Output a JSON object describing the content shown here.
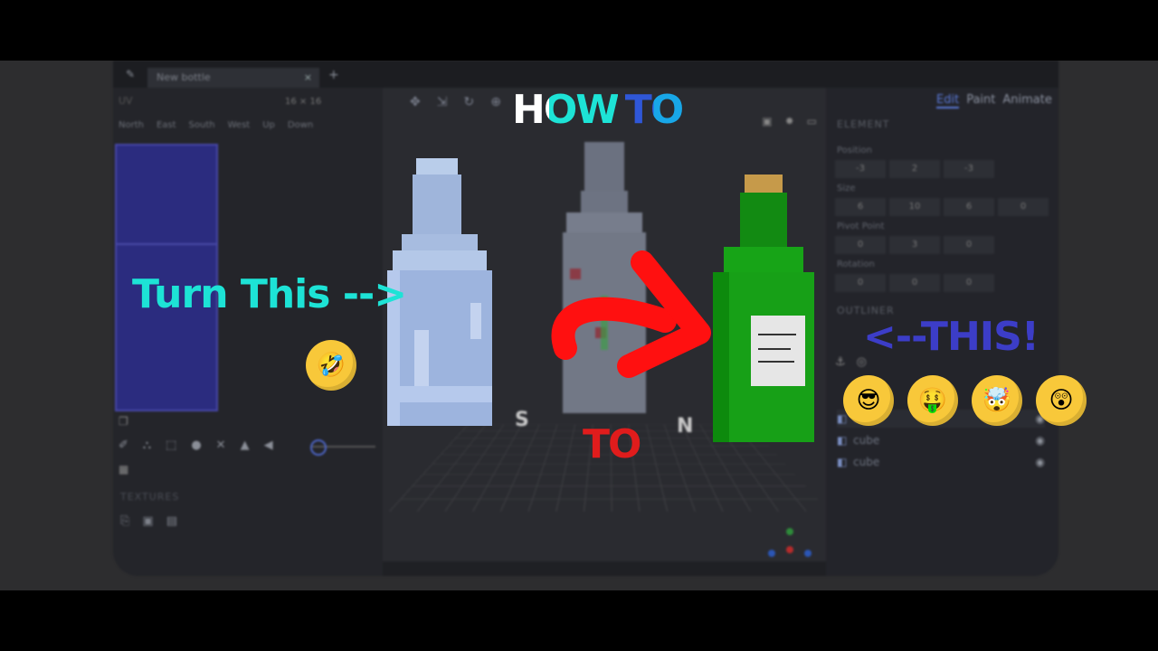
{
  "overlay": {
    "headline_part1": "HOW",
    "headline_part2": "TO",
    "left_caption": "Turn This -->",
    "right_caption": "<--THIS!",
    "middle_caption": "TO",
    "colors": {
      "how_white": "#ffffff",
      "how_cyan": "#1de3d6",
      "to_blue": "#2f57d8",
      "left_caption": "#1de3d6",
      "right_caption": "#3c3dc8",
      "middle_caption": "#e01c1c",
      "arrow": "#ff1010"
    }
  },
  "emojis": [
    {
      "name": "rofl-emoji",
      "glyph": "🤣"
    },
    {
      "name": "cool-sunglasses-emoji",
      "glyph": "😎"
    },
    {
      "name": "money-mouth-emoji",
      "glyph": "🤑"
    },
    {
      "name": "mind-blown-emoji",
      "glyph": "🤯"
    },
    {
      "name": "astonished-emoji",
      "glyph": "😲"
    }
  ],
  "app": {
    "tab_title": "New bottle",
    "tab_close": "×",
    "new_tab": "+",
    "texture_size": "16 × 16",
    "direction_tabs": [
      "North",
      "East",
      "South",
      "West",
      "Up",
      "Down"
    ],
    "textures_header": "TEXTURES",
    "modes": [
      "Edit",
      "Paint",
      "Animate"
    ],
    "active_mode": "Edit",
    "right_panel": {
      "element_header": "ELEMENT",
      "position_label": "Position",
      "position_values": [
        "-3",
        "2",
        "-3"
      ],
      "size_label": "Size",
      "size_values": [
        "6",
        "10",
        "6",
        "0"
      ],
      "pivot_label": "Pivot Point",
      "pivot_values": [
        "0",
        "3",
        "0"
      ],
      "rotation_label": "Rotation",
      "rotation_values": [
        "0",
        "0",
        "0"
      ],
      "outliner_header": "OUTLINER",
      "outliner_items": [
        "cube",
        "cube",
        "cube"
      ]
    },
    "viewport": {
      "compass_s": "S",
      "compass_n": "N"
    }
  }
}
